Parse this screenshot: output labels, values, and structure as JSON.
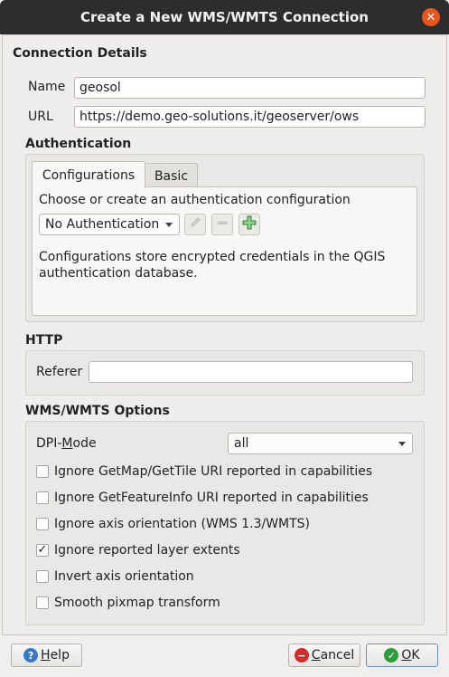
{
  "window": {
    "title": "Create a New WMS/WMTS Connection",
    "close_glyph": "✕"
  },
  "connection": {
    "section_title": "Connection Details",
    "name_label": "Name",
    "name_value": "geosol",
    "url_label": "URL",
    "url_value": "https://demo.geo-solutions.it/geoserver/ows"
  },
  "auth": {
    "section_title": "Authentication",
    "tabs": [
      {
        "label": "Configurations",
        "active": true
      },
      {
        "label": "Basic",
        "active": false
      }
    ],
    "prompt": "Choose or create an authentication configuration",
    "combo_value": "No Authentication",
    "info_line1": "Configurations store encrypted credentials in the QGIS",
    "info_line2": "authentication database.",
    "icons": [
      "edit-pencil-icon",
      "remove-icon",
      "add-plus-icon"
    ]
  },
  "http": {
    "section_title": "HTTP",
    "referer_label": "Referer",
    "referer_value": ""
  },
  "options": {
    "section_title": "WMS/WMTS Options",
    "dpi_label_pre": "DPI-",
    "dpi_label_mnemonic": "M",
    "dpi_label_post": "ode",
    "dpi_value": "all",
    "checkboxes": [
      {
        "label": "Ignore GetMap/GetTile URI reported in capabilities",
        "checked": false
      },
      {
        "label": "Ignore GetFeatureInfo URI reported in capabilities",
        "checked": false
      },
      {
        "label": "Ignore axis orientation (WMS 1.3/WMTS)",
        "checked": false
      },
      {
        "label": "Ignore reported layer extents",
        "checked": true
      },
      {
        "label": "Invert axis orientation",
        "checked": false
      },
      {
        "label": "Smooth pixmap transform",
        "checked": false
      }
    ],
    "check_glyph": "✓"
  },
  "buttons": {
    "help": {
      "pre": "",
      "mnemonic": "H",
      "post": "elp"
    },
    "cancel": {
      "pre": "",
      "mnemonic": "C",
      "post": "ancel"
    },
    "ok": {
      "pre": "",
      "mnemonic": "O",
      "post": "K"
    }
  },
  "colors": {
    "titlebar": "#2d2d2d",
    "close": "#e9541f",
    "help_icon": "#3b78c3",
    "cancel_icon": "#d22b2b",
    "ok_icon": "#2e9b3c"
  }
}
